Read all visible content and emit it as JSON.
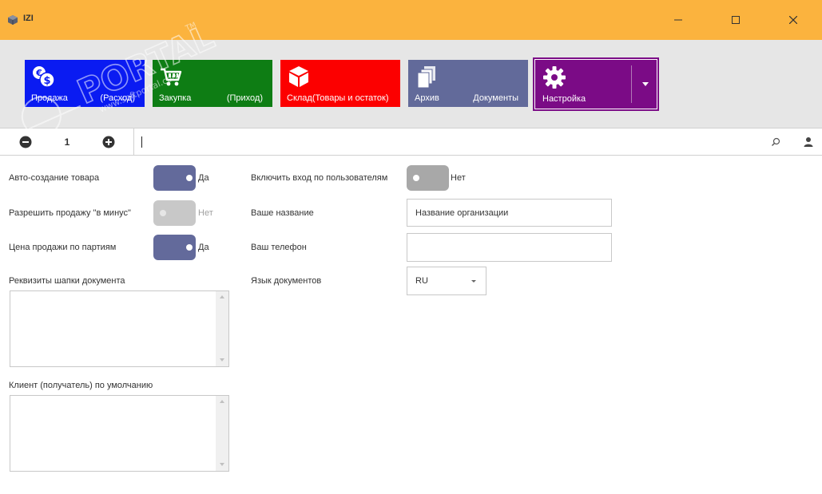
{
  "window": {
    "title": "IZI",
    "colors": {
      "titlebar": "#fbb33e",
      "toolbar_bg": "#e6e6e6"
    }
  },
  "watermark": {
    "text": "PORTAL",
    "mark": "TM",
    "url": "www.softportal.com"
  },
  "toolbar": {
    "tiles": [
      {
        "id": "sales",
        "label_left": "Продажа",
        "label_right": "(Расход)",
        "color": "#0a1bf2",
        "icon": "euro-dollar-coins-icon"
      },
      {
        "id": "purchase",
        "label_left": "Закупка",
        "label_right": "(Приход)",
        "color": "#0e7d14",
        "icon": "shopping-cart-icon"
      },
      {
        "id": "stock",
        "label_left": "Склад(Товары и остаток)",
        "label_right": "",
        "color": "#fc0000",
        "icon": "box-icon"
      },
      {
        "id": "archive",
        "label_left": "Архив",
        "label_right": "Документы",
        "color": "#626a9a",
        "icon": "documents-icon"
      },
      {
        "id": "settings",
        "label_left": "Настройка",
        "label_right": "",
        "color": "#7b0b86",
        "icon": "gear-icon"
      }
    ]
  },
  "quantity": {
    "value": "1"
  },
  "search": {
    "value": "",
    "placeholder": ""
  },
  "form": {
    "auto_create": {
      "label": "Авто-создание товара",
      "state": "on",
      "state_text": "Да"
    },
    "allow_negative": {
      "label": "Разрешить продажу \"в минус\"",
      "state": "disabled",
      "state_text": "Нет"
    },
    "price_by_batch": {
      "label": "Цена продажи по партиям",
      "state": "on",
      "state_text": "Да"
    },
    "doc_header": {
      "label": "Реквизиты шапки документа",
      "value": ""
    },
    "default_client": {
      "label": "Клиент (получатель) по умолчанию",
      "value": ""
    },
    "user_login": {
      "label": "Включить вход по пользователям",
      "state": "off",
      "state_text": "Нет"
    },
    "org_name": {
      "label": "Ваше название",
      "value": "Название организации"
    },
    "phone": {
      "label": "Ваш телефон",
      "value": ""
    },
    "doc_language": {
      "label": "Язык документов",
      "value": "RU"
    }
  }
}
